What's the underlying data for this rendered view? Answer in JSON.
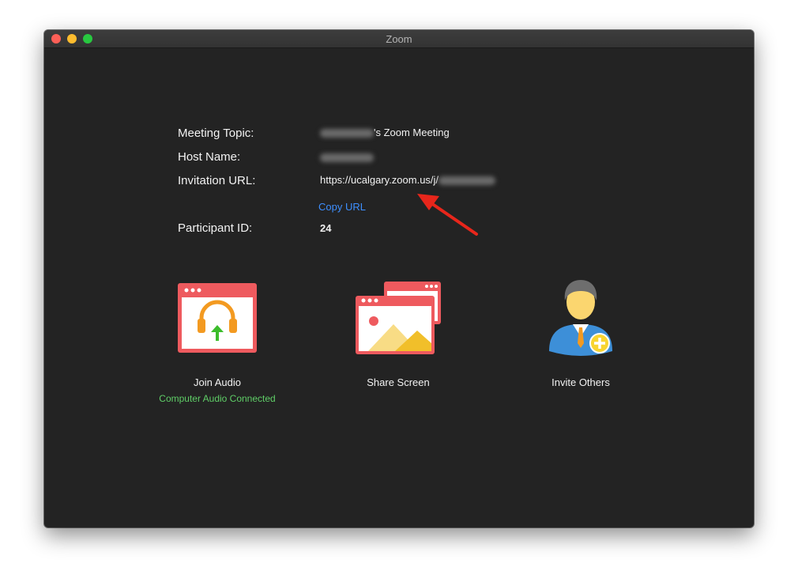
{
  "window": {
    "title": "Zoom"
  },
  "info": {
    "meeting_topic_label": "Meeting Topic:",
    "meeting_topic_suffix": "'s Zoom Meeting",
    "host_name_label": "Host Name:",
    "invitation_url_label": "Invitation URL:",
    "invitation_url_value": "https://ucalgary.zoom.us/j/",
    "copy_url": "Copy URL",
    "participant_id_label": "Participant ID:",
    "participant_id_value": "24"
  },
  "actions": {
    "join_audio": {
      "label": "Join Audio",
      "status": "Computer Audio Connected"
    },
    "share_screen": {
      "label": "Share Screen"
    },
    "invite_others": {
      "label": "Invite Others"
    }
  },
  "colors": {
    "background": "#232323",
    "link": "#3d8fff",
    "status": "#5fce67",
    "annotation_arrow": "#e8261b",
    "icon_red": "#ee5a5e"
  }
}
